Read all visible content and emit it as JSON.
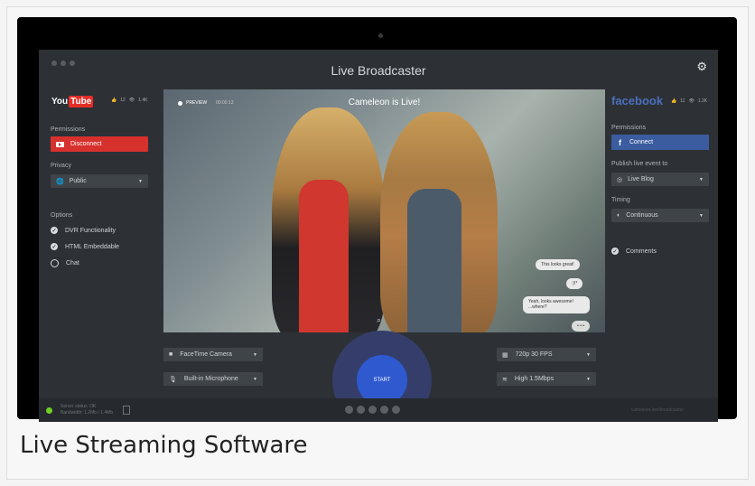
{
  "app": {
    "title": "Live Broadcaster",
    "settings_icon": "gear-icon"
  },
  "youtube": {
    "logo_left": "You",
    "logo_right": "Tube",
    "likes": "12",
    "views": "1.4K",
    "permissions_label": "Permissions",
    "disconnect_label": "Disconnect",
    "privacy_label": "Privacy",
    "privacy_value": "Public",
    "options_label": "Options",
    "options": [
      {
        "label": "DVR Functionality",
        "checked": true
      },
      {
        "label": "HTML Embeddable",
        "checked": true
      },
      {
        "label": "Chat",
        "checked": false
      }
    ]
  },
  "video": {
    "preview_label": "PREVIEW",
    "preview_time": "00:00:13",
    "overlay_title": "Cameleon is Live!",
    "chat": [
      "This looks great!",
      ":)!*",
      "Yeah, looks awesome!",
      "...where?",
      "• • •"
    ]
  },
  "controls": {
    "camera": "FaceTime Camera",
    "microphone": "Built-in Microphone",
    "start_label": "START",
    "resolution": "720p 30 FPS",
    "bitrate": "High 1.5Mbps"
  },
  "facebook": {
    "logo": "facebook",
    "likes": "11",
    "views": "1.2K",
    "permissions_label": "Permissions",
    "connect_label": "Connect",
    "publish_label": "Publish live event to",
    "publish_value": "Live Blog",
    "timing_label": "Timing",
    "timing_value": "Continuous",
    "comments_label": "Comments"
  },
  "status": {
    "line1": "Server status: OK",
    "line2": "Bandwidth: 1.2Mb / 1.4Mb",
    "right_text": "cameleon.live/broadcaster"
  },
  "caption": "Live Streaming Software",
  "colors": {
    "youtube_red": "#d6312d",
    "facebook_blue": "#3b5c9f",
    "start_blue": "#2f59cf",
    "status_ok": "#6fd124"
  }
}
